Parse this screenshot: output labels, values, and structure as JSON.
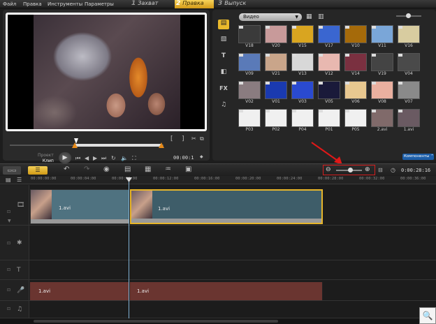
{
  "menu": {
    "items": [
      "Файл",
      "Правка",
      "Инструменты",
      "Параметры"
    ],
    "steps": [
      {
        "num": "1",
        "label": "Захват"
      },
      {
        "num": "2",
        "label": "Правка"
      },
      {
        "num": "3",
        "label": "Выпуск"
      }
    ],
    "active_step": "2"
  },
  "preview": {
    "mode_project": "Проект",
    "mode_clip": "Клип",
    "timecode": "00:00:1",
    "mark_in": "[",
    "mark_out": "]",
    "play_icon": "play-icon"
  },
  "library": {
    "dropdown": "Видео",
    "thumbs": [
      {
        "label": "V18",
        "color": "#3a3a3a"
      },
      {
        "label": "V20",
        "color": "#c89a9a"
      },
      {
        "label": "V15",
        "color": "#d9a520"
      },
      {
        "label": "V17",
        "color": "#3a66d0"
      },
      {
        "label": "V10",
        "color": "#a56a0a"
      },
      {
        "label": "V11",
        "color": "#7aa6d8"
      },
      {
        "label": "V16",
        "color": "#d8cca0"
      },
      {
        "label": "V09",
        "color": "#5a7ab8"
      },
      {
        "label": "V21",
        "color": "#c9a58a"
      },
      {
        "label": "V13",
        "color": "#d8d8d8"
      },
      {
        "label": "V12",
        "color": "#e8b8b0"
      },
      {
        "label": "V14",
        "color": "#7a3040"
      },
      {
        "label": "V19",
        "color": "#444444"
      },
      {
        "label": "V04",
        "color": "#4a4a4a"
      },
      {
        "label": "V02",
        "color": "#8a7c80"
      },
      {
        "label": "V01",
        "color": "#1a3ab0"
      },
      {
        "label": "V03",
        "color": "#2a4ad0"
      },
      {
        "label": "V05",
        "color": "#1a1a3a"
      },
      {
        "label": "V06",
        "color": "#e8c890"
      },
      {
        "label": "V08",
        "color": "#eab0a0"
      },
      {
        "label": "V07",
        "color": "#8a8a8a"
      },
      {
        "label": "P03",
        "color": "#f0f0f0"
      },
      {
        "label": "P02",
        "color": "#f0f0f0"
      },
      {
        "label": "P04",
        "color": "#f0f0f0"
      },
      {
        "label": "P01",
        "color": "#f0f0f0"
      },
      {
        "label": "P05",
        "color": "#f0f0f0"
      },
      {
        "label": "2.avi",
        "color": "#806a6a"
      },
      {
        "label": "1.avi",
        "color": "#6a5a62"
      }
    ],
    "components_label": "Компоненты"
  },
  "timeline": {
    "timecode": "0:00:28:16",
    "ruler": [
      "00:00:00:00",
      "00:00:04:00",
      "00:00:08:00",
      "00:00:12:00",
      "00:00:16:00",
      "00:00:20:00",
      "00:00:24:00",
      "00:00:28:00",
      "00:00:32:00",
      "00:00:36:00"
    ],
    "video_clips": [
      {
        "label": "1.avi"
      },
      {
        "label": "1.avi"
      }
    ],
    "audio_clips": [
      {
        "label": "1.avi"
      },
      {
        "label": "1.avi"
      }
    ],
    "zoom_level": 0.55
  },
  "colors": {
    "accent": "#e7b52a",
    "highlight_box": "#d41e1e",
    "video_clip": "#4f7280",
    "audio_clip": "#6a3530"
  }
}
